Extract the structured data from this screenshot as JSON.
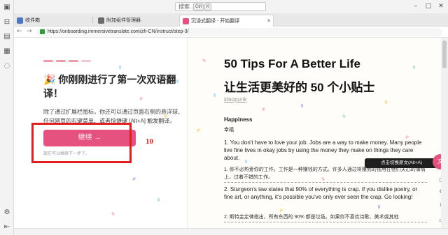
{
  "titlebar": {
    "search_placeholder": "搜索...",
    "shortcut_keys": [
      "Ctrl",
      "K"
    ],
    "window_buttons": [
      "minimize-icon",
      "maximize-icon",
      "close-icon"
    ]
  },
  "tabs": [
    {
      "label": "收件箱",
      "icon": "mail-icon",
      "color": "#4a78c2",
      "active": false
    },
    {
      "label": "附加组件管理器",
      "icon": "puzzle-icon",
      "color": "#6b6b6b",
      "active": false
    },
    {
      "label": "沉浸式翻译 - 开始翻译",
      "icon": "translate-icon",
      "color": "#e5527f",
      "active": true
    }
  ],
  "address_bar": {
    "url": "https://onboarding.immersivetranslate.com/zh-CN/instruct/step-3/"
  },
  "onboarding": {
    "heading": "🎉 你刚刚进行了第一次双语翻译！",
    "description": "除了通过扩展栏图标，你还可以通过页面右侧的悬浮球、任何网页的右键菜单、或者快捷键 [Alt+A] 触发翻译。",
    "continue_button": "继续 →",
    "sub_hint": "现在可以继续下一步了。",
    "annotation_number": "10"
  },
  "article": {
    "title": "50 Tips For A Better Life",
    "title_zh": "让生活更美好的 50 个小贴士",
    "author": "ideopunk",
    "section": "Happiness",
    "section_zh": "幸福",
    "p1": "1. You don't have to love your job. Jobs are a way to make money. Many people live fine lives in okay jobs by using the money they make on things they care about.",
    "p1_zh": "1. 你不必热爱你的工作。工作是一种赚钱的方式。许多人通过将赚到的钱用在他们关心的事情上，过着不错的工作。",
    "p2": "2. Sturgeon's law states that 90% of everything is crap. If you dislike poetry, or fine art, or anything, it's possible you've only ever seen the crap. Go looking!",
    "p2_zh": "2. 斯特金定律指出，所有东西的 90% 都是垃圾。如果你不喜欢诗歌、美术或其他"
  },
  "floating": {
    "tooltip": "点击切换原文(Alt+A)",
    "float_icon": "translate-icon"
  },
  "sidebar_icons": [
    "reader-icon",
    "bookmark-icon",
    "reading-list-icon",
    "history-icon",
    "chat-icon",
    "settings-icon",
    "collapse-icon"
  ],
  "colors": {
    "accent": "#e5527f",
    "annotation": "#e21f1f"
  }
}
